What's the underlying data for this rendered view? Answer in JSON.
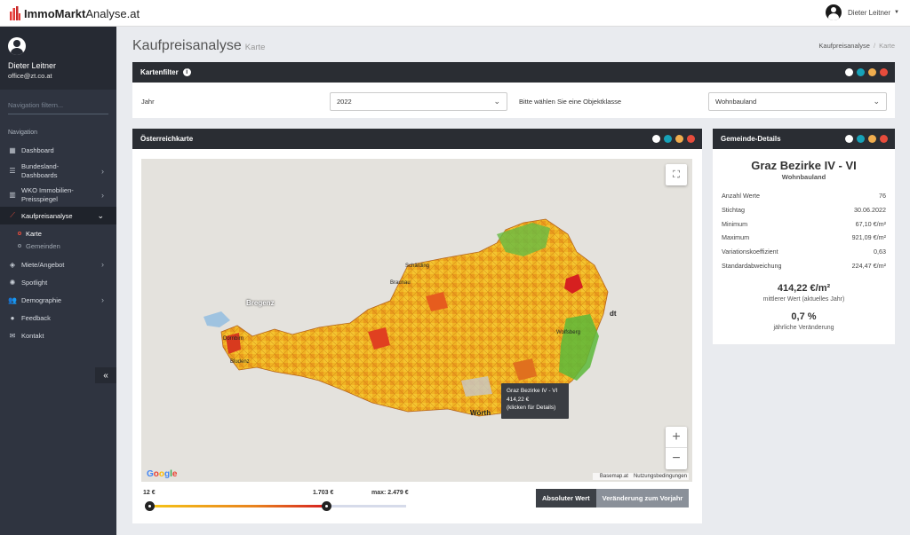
{
  "app": {
    "brand_bold": "ImmoMarkt",
    "brand_light": "Analyse.at",
    "top_user": "Dieter Leitner"
  },
  "sidebar": {
    "user_name": "Dieter Leitner",
    "user_email": "office@zt.co.at",
    "filter_placeholder": "Navigation filtern...",
    "section": "Navigation",
    "items": [
      {
        "label": "Dashboard",
        "icon": "dashboard-icon"
      },
      {
        "label": "Bundesland-Dashboards",
        "icon": "list-icon"
      },
      {
        "label": "WKO Immobilien-Preisspiegel",
        "icon": "bar-chart-icon"
      },
      {
        "label": "Kaufpreisanalyse",
        "icon": "line-chart-icon"
      },
      {
        "label": "Miete/Angebot",
        "icon": "layers-icon"
      },
      {
        "label": "Spotlight",
        "icon": "lightbulb-icon"
      },
      {
        "label": "Demographie",
        "icon": "users-icon"
      },
      {
        "label": "Feedback",
        "icon": "chat-icon"
      },
      {
        "label": "Kontakt",
        "icon": "envelope-icon"
      }
    ],
    "subitems": [
      {
        "label": "Karte"
      },
      {
        "label": "Gemeinden"
      }
    ]
  },
  "page": {
    "title": "Kaufpreisanalyse",
    "subtitle": "Karte",
    "breadcrumb": [
      "Kaufpreisanalyse",
      "Karte"
    ]
  },
  "filter_panel": {
    "title": "Kartenfilter",
    "year_label": "Jahr",
    "year_value": "2022",
    "class_label": "Bitte wählen Sie eine Objektklasse",
    "class_value": "Wohnbauland"
  },
  "map_panel": {
    "title": "Österreichkarte",
    "tooltip": {
      "name": "Graz Bezirke IV - VI",
      "value": "414,22 €",
      "hint": "(klicken für Details)"
    },
    "labels": [
      "Bregenz",
      "Dornbirn",
      "Bludenz",
      "Schärding",
      "Braunau",
      "dt",
      "Wolfsberg",
      "Wörth"
    ],
    "google": "Google",
    "attribution": [
      "Basemap.at",
      "Nutzungsbedingungen"
    ],
    "legend": {
      "min": "12 €",
      "current": "1.703 €",
      "max": "max: 2.479 €",
      "position_fraction": 0.687
    },
    "toggle": {
      "active": "Absoluter Wert",
      "inactive": "Veränderung zum Vorjahr"
    },
    "colors": {
      "low": "#f5c518",
      "mid": "#e8821e",
      "high": "#d62020",
      "green": "#4caf3a"
    }
  },
  "details_panel": {
    "title": "Gemeinde-Details",
    "name": "Graz Bezirke IV - VI",
    "class": "Wohnbauland",
    "rows": [
      {
        "label": "Anzahl Werte",
        "value": "76"
      },
      {
        "label": "Stichtag",
        "value": "30.06.2022"
      },
      {
        "label": "Minimum",
        "value": "67,10 €/m²"
      },
      {
        "label": "Maximum",
        "value": "921,09 €/m²"
      },
      {
        "label": "Variationskoeffizient",
        "value": "0,63"
      },
      {
        "label": "Standardabweichung",
        "value": "224,47 €/m²"
      }
    ],
    "avg_value": "414,22 €/m²",
    "avg_label": "mittlerer Wert (aktuelles Jahr)",
    "change_value": "0,7 %",
    "change_label": "jährliche Veränderung"
  }
}
